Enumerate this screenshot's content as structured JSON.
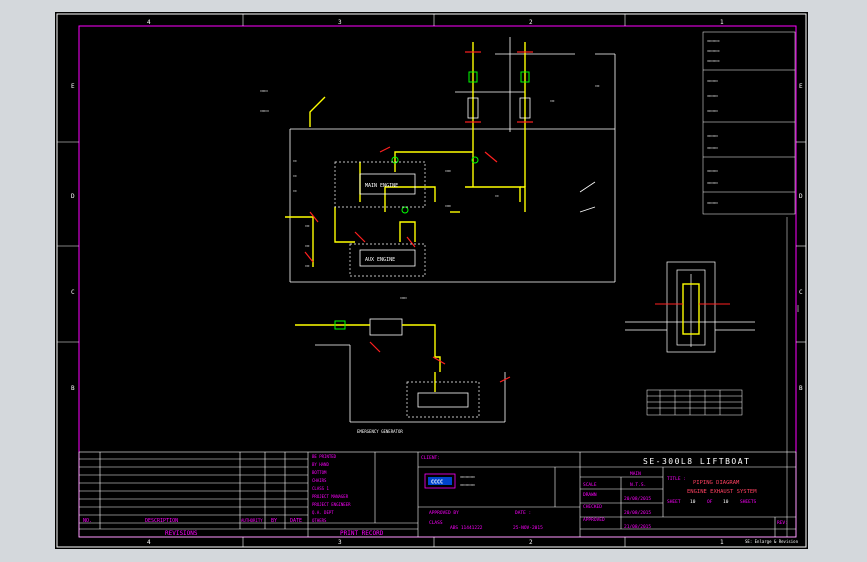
{
  "project": {
    "title": "SE-300L8 LIFTBOAT"
  },
  "drawing": {
    "title_line1": "PIPING DIAGRAM",
    "title_line2": "ENGINE EXHAUST SYSTEM",
    "dwg_no": "MAIN",
    "scale": "N.T.S.",
    "date_drawn": "20/08/2015",
    "date_checked": "20/08/2015",
    "date_approved": "21/08/2015",
    "sheet_no": "10",
    "sheet_of": "10",
    "sheets_label": "SHEETS",
    "approved_date": "25-NOV-2015",
    "footer_note": "SE: Enlarge & Revision"
  },
  "labels": {
    "client": "CLIENT:",
    "approved_by": "APPROVED BY",
    "date": "DATE :",
    "class": "CLASS",
    "class_value": "ABS 11441222",
    "drawn": "DRAWN",
    "checked": "CHECKED",
    "approved": "APPROVED",
    "scale": "SCALE",
    "title": "TITLE :",
    "sheet": "SHEET",
    "of": "OF",
    "rev": "REV:",
    "no": "NO.",
    "description": "DESCRIPTION",
    "authority": "AUTHORITY",
    "by": "BY",
    "date_col": "DATE",
    "revisions": "REVISIONS",
    "print_record": "PRINT RECORD",
    "main_engine": "MAIN ENGINE",
    "aux_engine": "AUX ENGINE",
    "emergency_gen": "EMERGENCY GENERATOR"
  },
  "print_record": [
    "BE PRINTED",
    "BY HAND",
    "BOTTOM",
    "CHAIRS",
    "CLASS 1",
    "PROJECT MANAGER",
    "PROJECT ENGINEER",
    "Q.A. DEPT",
    "OTHERS"
  ],
  "grid": {
    "top": [
      "4",
      "3",
      "2",
      "1"
    ],
    "left": [
      "E",
      "D",
      "C",
      "B"
    ]
  },
  "colors": {
    "sheet": "#000000",
    "frame": "#ff00ff",
    "pipe": "#ffff00",
    "valve": "#ff2020",
    "text": "#ffffff",
    "accent": "#00ff00",
    "cyan": "#00ffff"
  }
}
